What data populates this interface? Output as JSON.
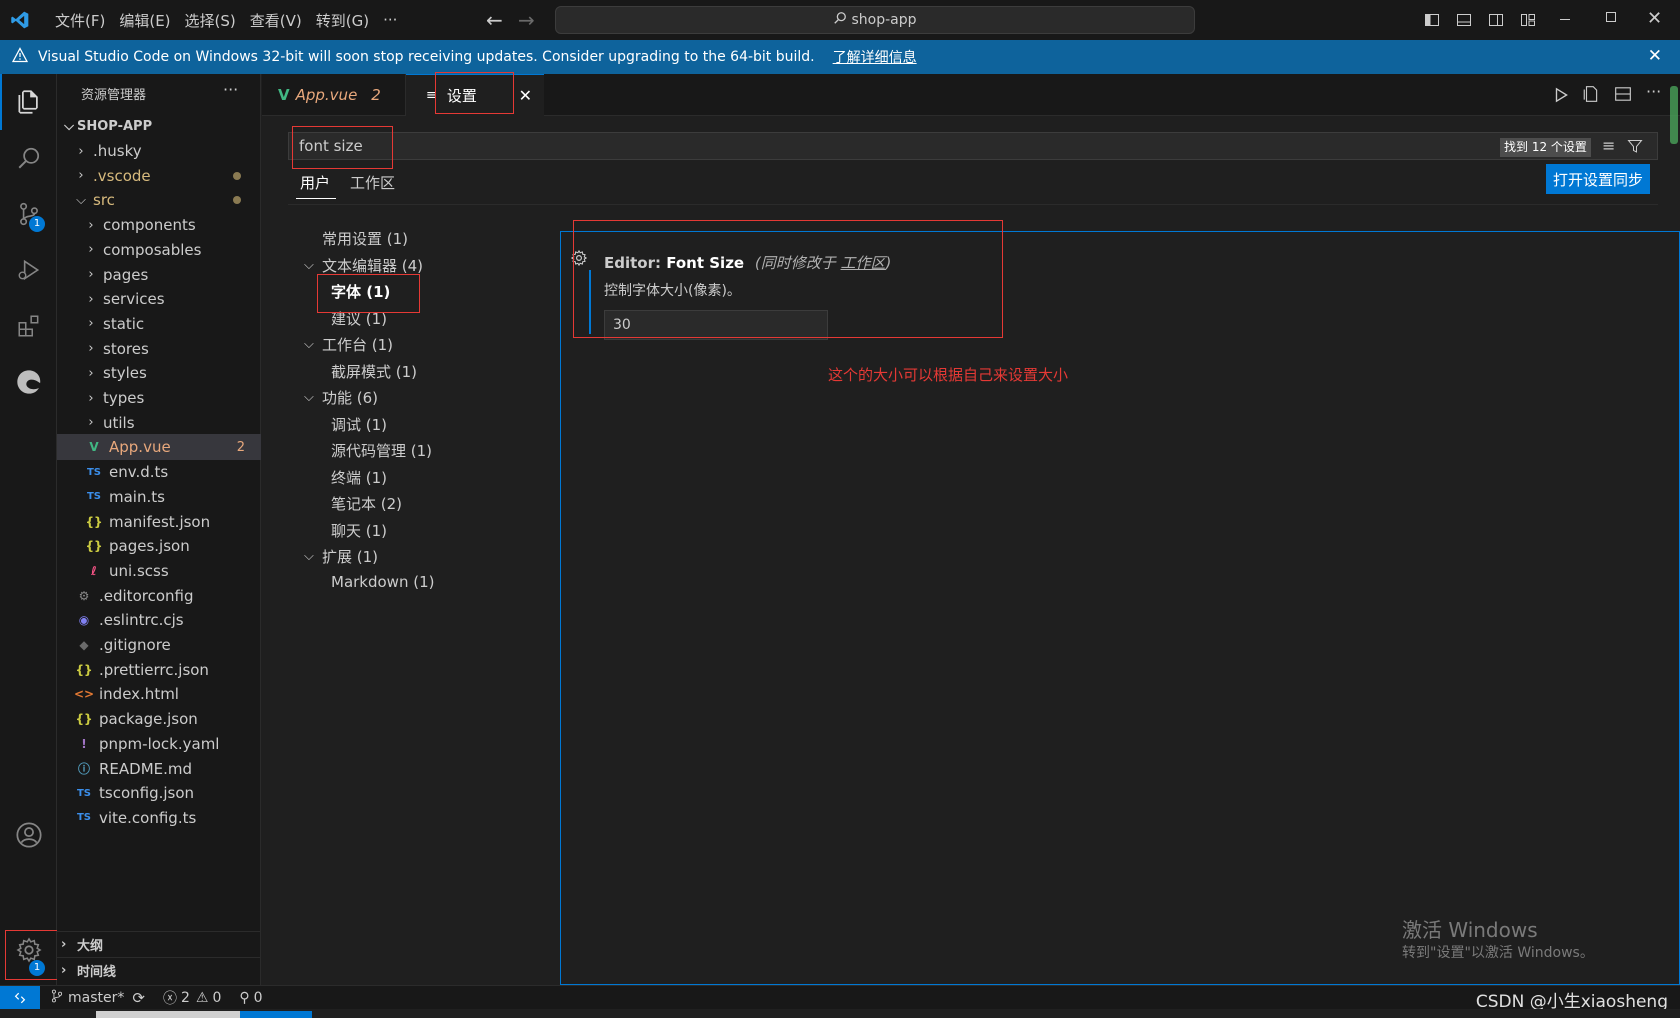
{
  "titlebar": {
    "menus": [
      "文件(F)",
      "编辑(E)",
      "选择(S)",
      "查看(V)",
      "转到(G)",
      "···"
    ],
    "search": "shop-app"
  },
  "banner": {
    "message": "Visual Studio Code on Windows 32-bit will soon stop receiving updates. Consider upgrading to the 64-bit build.",
    "link": "了解详细信息"
  },
  "activity": {
    "scm_badge": "1",
    "manage_badge": "1"
  },
  "sidebar": {
    "title": "资源管理器",
    "more": "···",
    "root": "SHOP-APP",
    "items": [
      {
        "label": ".husky",
        "icon": "chevron-right"
      },
      {
        "label": ".vscode",
        "icon": "chevron-right"
      },
      {
        "label": "src",
        "icon": "chevron-down"
      },
      {
        "label": "components",
        "icon": "chevron-right"
      },
      {
        "label": "composables",
        "icon": "chevron-right"
      },
      {
        "label": "pages",
        "icon": "chevron-right"
      },
      {
        "label": "services",
        "icon": "chevron-right"
      },
      {
        "label": "static",
        "icon": "chevron-right"
      },
      {
        "label": "stores",
        "icon": "chevron-right"
      },
      {
        "label": "styles",
        "icon": "chevron-right"
      },
      {
        "label": "types",
        "icon": "chevron-right"
      },
      {
        "label": "utils",
        "icon": "chevron-right"
      },
      {
        "label": "App.vue",
        "icon": "vue-icon",
        "badge": "2"
      },
      {
        "label": "env.d.ts",
        "icon": "ts-icon",
        "glyph": "TS"
      },
      {
        "label": "main.ts",
        "icon": "ts-icon",
        "glyph": "TS"
      },
      {
        "label": "manifest.json",
        "icon": "json-icon",
        "glyph": "{}"
      },
      {
        "label": "pages.json",
        "icon": "json-icon",
        "glyph": "{}"
      },
      {
        "label": "uni.scss",
        "icon": "scss-icon"
      },
      {
        "label": ".editorconfig",
        "icon": "gear-icon"
      },
      {
        "label": ".eslintrc.cjs",
        "icon": "eslint-icon"
      },
      {
        "label": ".gitignore",
        "icon": "git-icon"
      },
      {
        "label": ".prettierrc.json",
        "icon": "json-icon",
        "glyph": "{}"
      },
      {
        "label": "index.html",
        "icon": "html-icon",
        "glyph": "<>"
      },
      {
        "label": "package.json",
        "icon": "json-icon",
        "glyph": "{}"
      },
      {
        "label": "pnpm-lock.yaml",
        "icon": "yaml-icon",
        "glyph": "!"
      },
      {
        "label": "README.md",
        "icon": "info-icon",
        "glyph": "ⓘ"
      },
      {
        "label": "tsconfig.json",
        "icon": "tsconfig-icon",
        "glyph": "TS"
      },
      {
        "label": "vite.config.ts",
        "icon": "ts-icon",
        "glyph": "TS"
      }
    ],
    "outline": "大纲",
    "timeline": "时间线"
  },
  "tabs": [
    {
      "label": "App.vue",
      "badge": "2"
    },
    {
      "label": "设置"
    }
  ],
  "settings": {
    "query": "font size",
    "result_count": "找到 12 个设置",
    "scope_user": "用户",
    "scope_workspace": "工作区",
    "sync_button": "打开设置同步",
    "toc": [
      {
        "label": "常用设置 (1)"
      },
      {
        "label": "文本编辑器 (4)"
      },
      {
        "label": "字体 (1)"
      },
      {
        "label": "建议 (1)"
      },
      {
        "label": "工作台 (1)"
      },
      {
        "label": "截屏模式 (1)"
      },
      {
        "label": "功能 (6)"
      },
      {
        "label": "调试 (1)"
      },
      {
        "label": "源代码管理 (1)"
      },
      {
        "label": "终端 (1)"
      },
      {
        "label": "笔记本 (2)"
      },
      {
        "label": "聊天 (1)"
      },
      {
        "label": "扩展 (1)"
      },
      {
        "label": "Markdown (1)"
      }
    ],
    "item": {
      "category": "Editor: ",
      "name": "Font Size",
      "modified": "(同时修改于 ",
      "modified_link": "工作区",
      "modified_close": ")",
      "description": "控制字体大小(像素)。",
      "value": "30"
    },
    "annotation": "这个的大小可以根据自己来设置大小",
    "watermark_title": "激活 Windows",
    "watermark_sub": "转到\"设置\"以激活 Windows。"
  },
  "statusbar": {
    "branch": "master*",
    "errors": "2",
    "warnings": "0",
    "ports": "0",
    "csdn": "CSDN @小生xiaosheng"
  },
  "colors": {
    "accent": "#0e639c",
    "vscode_blue": "#0078d4",
    "annotation_red": "#e53935",
    "vue_green": "#41b883",
    "modified_orange": "#e8a87c"
  }
}
